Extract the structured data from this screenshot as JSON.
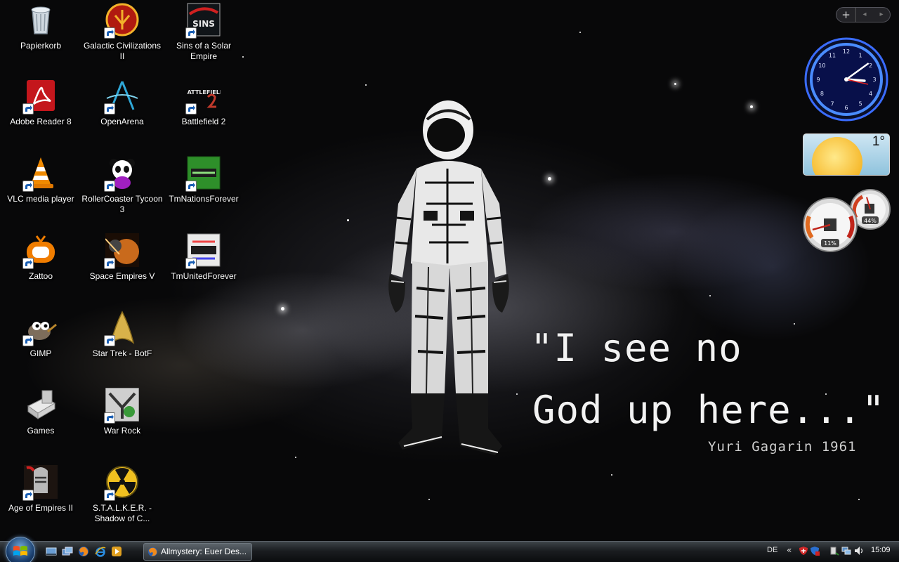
{
  "desktop": {
    "icons": [
      {
        "label": "Papierkorb",
        "icon": "recycle-bin-icon",
        "shortcut": false
      },
      {
        "label": "Adobe Reader 8",
        "icon": "adobe-reader-icon",
        "shortcut": true
      },
      {
        "label": "VLC media player",
        "icon": "vlc-cone-icon",
        "shortcut": true
      },
      {
        "label": "Zattoo",
        "icon": "zattoo-tv-icon",
        "shortcut": true
      },
      {
        "label": "GIMP",
        "icon": "gimp-mascot-icon",
        "shortcut": true
      },
      {
        "label": "Games",
        "icon": "games-folder-icon",
        "shortcut": false
      },
      {
        "label": "Age of Empires II",
        "icon": "knight-helmet-icon",
        "shortcut": true
      },
      {
        "label": "Galactic Civilizations II",
        "icon": "galactic-civ-emblem-icon",
        "shortcut": true
      },
      {
        "label": "OpenArena",
        "icon": "openarena-logo-icon",
        "shortcut": true
      },
      {
        "label": "RollerCoaster Tycoon 3",
        "icon": "panda-icon",
        "shortcut": true
      },
      {
        "label": "Space Empires V",
        "icon": "planet-icon",
        "shortcut": true
      },
      {
        "label": "Star Trek - BotF",
        "icon": "starfleet-badge-icon",
        "shortcut": true
      },
      {
        "label": "War Rock",
        "icon": "war-rock-icon",
        "shortcut": true
      },
      {
        "label": "S.T.A.L.K.E.R. - Shadow of C...",
        "icon": "radiation-icon",
        "shortcut": true
      },
      {
        "label": "Sins of a Solar Empire",
        "icon": "sins-logo-icon",
        "shortcut": true,
        "logo_text": "SINS"
      },
      {
        "label": "Battlefield 2",
        "icon": "battlefield-logo-icon",
        "shortcut": true,
        "logo_text": "BATTLEFIELD"
      },
      {
        "label": "TmNationsForever",
        "icon": "tm-nations-icon",
        "shortcut": true
      },
      {
        "label": "TmUnitedForever",
        "icon": "tm-united-icon",
        "shortcut": true
      }
    ]
  },
  "wallpaper": {
    "quote_line_1": "\"I see no",
    "quote_line_2": "God up here...\"",
    "author": "Yuri Gagarin 1961"
  },
  "sidebar": {
    "add_symbol": "+",
    "prev_symbol": "◂",
    "next_symbol": "▸",
    "clock": {
      "hour": 3,
      "minute": 9,
      "numerals": [
        "12",
        "1",
        "2",
        "3",
        "4",
        "5",
        "6",
        "7",
        "8",
        "9",
        "10",
        "11"
      ]
    },
    "weather": {
      "temperature": "1°"
    },
    "cpu_meter": {
      "cpu_percent": "11%",
      "memory_percent": "44%",
      "cpu_value": 11,
      "memory_value": 44
    }
  },
  "taskbar": {
    "window_title": "Allmystery: Euer Des...",
    "language": "DE",
    "tray_expand": "«",
    "time": "15:09"
  },
  "colors": {
    "clock_ring": "#1e5bff",
    "clock_face": "#08104a",
    "meter_red": "#c0241a"
  }
}
